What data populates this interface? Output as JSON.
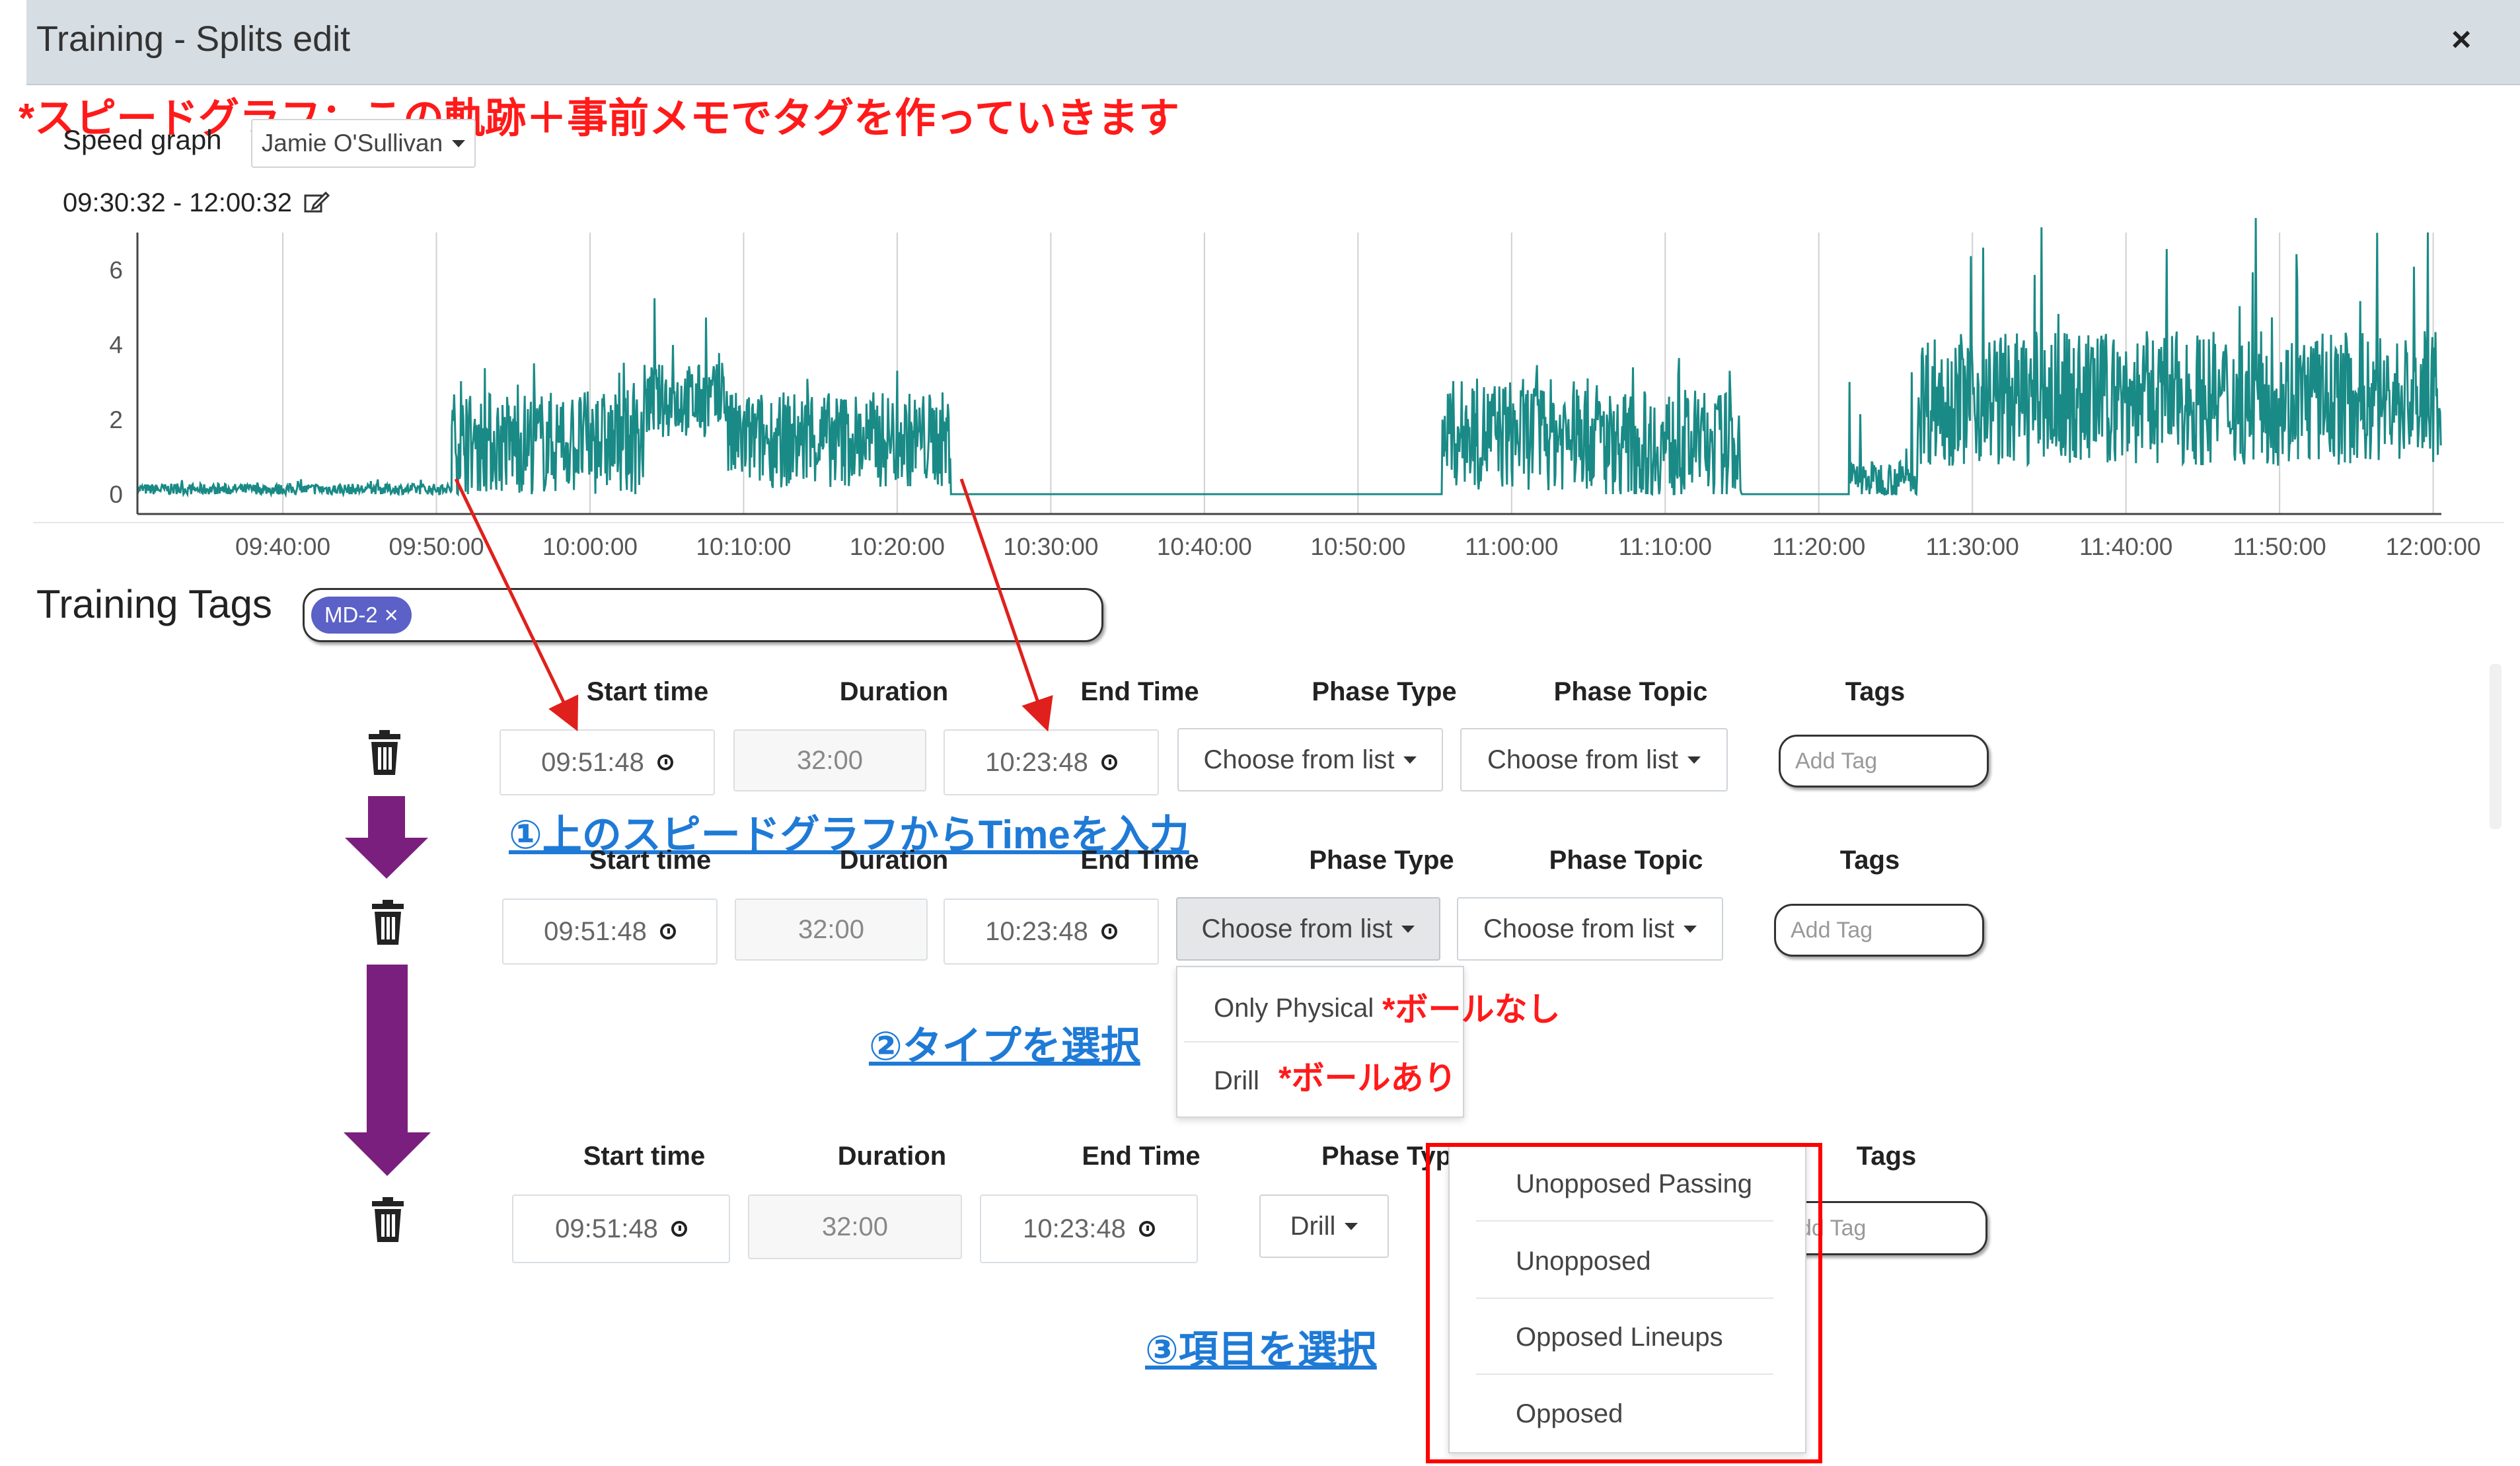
{
  "window": {
    "title": "Training - Splits edit",
    "close_label": "×"
  },
  "annotations": {
    "speed_graph_note": "*スピードグラフ：この軌跡＋事前メモでタグを作っていきます",
    "step1": "①上のスピードグラフからTimeを入力",
    "step2": "②タイプを選択",
    "step3": "③項目を選択",
    "no_ball": "*ボールなし",
    "with_ball": "*ボールあり",
    "arrow_color": "#7b1f7e",
    "highlight_color": "#ff0000"
  },
  "speed_graph": {
    "label": "Speed graph",
    "player_select": "Jamie O'Sullivan",
    "time_range": "09:30:32 - 12:00:32"
  },
  "chart_data": {
    "type": "line",
    "title": "",
    "xlabel": "",
    "ylabel": "",
    "color": "#1a8a86",
    "y_ticks": [
      "0",
      "2",
      "4",
      "6"
    ],
    "ylim": [
      0,
      7
    ],
    "x_ticks": [
      "09:40:00",
      "09:50:00",
      "10:00:00",
      "10:10:00",
      "10:20:00",
      "10:30:00",
      "10:40:00",
      "10:50:00",
      "11:00:00",
      "11:10:00",
      "11:20:00",
      "11:30:00",
      "11:40:00",
      "11:50:00",
      "12:00:00"
    ],
    "xlim": [
      "09:30:32",
      "12:00:32"
    ],
    "grid": true,
    "series": [
      {
        "segments": [
          {
            "start": "09:30:32",
            "end": "09:51:00",
            "mean": 0.1,
            "amp": 0.15,
            "peak": 0.4
          },
          {
            "start": "09:51:00",
            "end": "10:03:30",
            "mean": 1.1,
            "amp": 1.4,
            "peak": 3.6
          },
          {
            "start": "10:03:30",
            "end": "10:09:00",
            "mean": 2.3,
            "amp": 1.0,
            "peak": 5.3
          },
          {
            "start": "10:09:00",
            "end": "10:23:30",
            "mean": 1.2,
            "amp": 1.3,
            "peak": 3.5
          },
          {
            "start": "10:23:30",
            "end": "10:55:30",
            "mean": 0.0,
            "amp": 0.02,
            "peak": 0.1
          },
          {
            "start": "10:55:30",
            "end": "11:06:00",
            "mean": 1.3,
            "amp": 1.5,
            "peak": 3.8
          },
          {
            "start": "11:06:00",
            "end": "11:15:00",
            "mean": 1.0,
            "amp": 1.5,
            "peak": 3.7
          },
          {
            "start": "11:15:00",
            "end": "11:22:00",
            "mean": 0.0,
            "amp": 0.02,
            "peak": 0.1
          },
          {
            "start": "11:22:00",
            "end": "11:26:30",
            "mean": 0.3,
            "amp": 0.5,
            "peak": 3.5
          },
          {
            "start": "11:26:30",
            "end": "12:00:32",
            "mean": 2.2,
            "amp": 1.8,
            "peak": 7.4
          }
        ]
      }
    ]
  },
  "training_tags": {
    "label": "Training Tags",
    "chip": "MD-2",
    "chip_remove": "×"
  },
  "columns": {
    "start": "Start time",
    "duration": "Duration",
    "end": "End Time",
    "phase_type": "Phase Type",
    "phase_topic": "Phase Topic",
    "tags": "Tags"
  },
  "rows": [
    {
      "start": "09:51:48",
      "duration": "32:00",
      "end": "10:23:48",
      "phase_type": "Choose from list",
      "phase_topic": "Choose from list",
      "tags_placeholder": "Add Tag"
    },
    {
      "start": "09:51:48",
      "duration": "32:00",
      "end": "10:23:48",
      "phase_type": "Choose from list",
      "phase_topic": "Choose from list",
      "tags_placeholder": "Add Tag"
    },
    {
      "start": "09:51:48",
      "duration": "32:00",
      "end": "10:23:48",
      "phase_type": "Drill",
      "tags_placeholder": "dd Tag"
    }
  ],
  "row3_phase_type_header": "Phase Typ",
  "phase_type_menu": [
    "Only Physical",
    "Drill"
  ],
  "phase_topic_menu": [
    "Unopposed Passing",
    "Unopposed",
    "Opposed Lineups",
    "Opposed"
  ]
}
